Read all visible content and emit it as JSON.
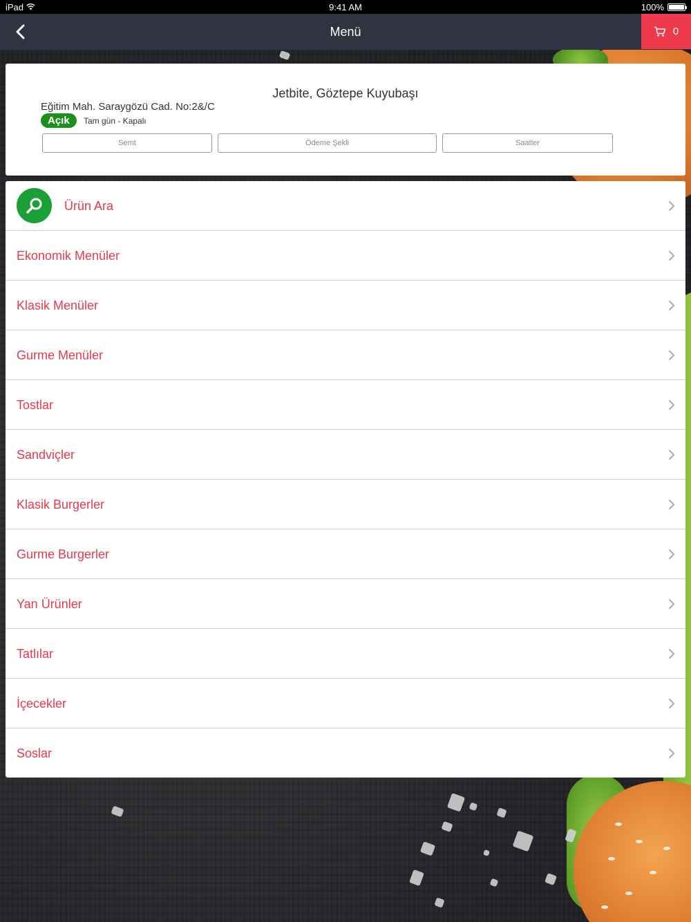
{
  "status_bar": {
    "device": "iPad",
    "time": "9:41 AM",
    "battery": "100%"
  },
  "nav": {
    "title": "Menü",
    "cart_count": "0"
  },
  "restaurant": {
    "name": "Jetbite, Göztepe Kuyubaşı",
    "address": "Eğitim Mah. Saraygözü Cad. No:2&/C",
    "status": "Açık",
    "hours": "Tam gün - Kapalı",
    "buttons": {
      "district": "Semt",
      "payment": "Ödeme Şekli",
      "hours": "Saatler"
    }
  },
  "menu": {
    "search_label": "Ürün Ara",
    "categories": [
      "Ekonomik Menüler",
      "Klasik Menüler",
      "Gurme Menüler",
      "Tostlar",
      "Sandviçler",
      "Klasik Burgerler",
      "Gurme Burgerler",
      "Yan Ürünler",
      "Tatlılar",
      "İçecekler",
      "Soslar"
    ]
  },
  "colors": {
    "accent": "#e8394a",
    "navbar": "#303340",
    "cart": "#ee3a4a",
    "open_badge": "#1e8e1e",
    "search_circle": "#1aa036"
  }
}
